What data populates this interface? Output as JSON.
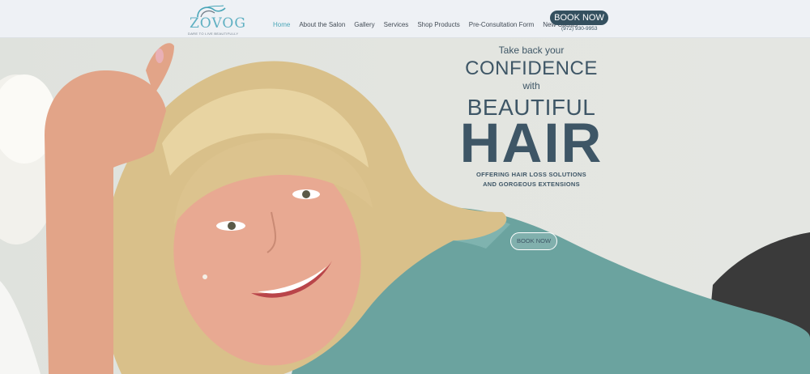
{
  "colors": {
    "accent": "#4aa6b8",
    "brand_dark": "#34505f",
    "hero_text": "#3e5666",
    "nav_bg": "#eef1f5"
  },
  "logo": {
    "word": "ZOVOG",
    "tagline": "DARE TO LIVE BEAUTIFULLY",
    "icon": "hair-swirl-logo-icon"
  },
  "nav": {
    "items": [
      {
        "label": "Home",
        "active": true
      },
      {
        "label": "About the Salon",
        "active": false
      },
      {
        "label": "Gallery",
        "active": false
      },
      {
        "label": "Services",
        "active": false
      },
      {
        "label": "Shop Products",
        "active": false
      },
      {
        "label": "Pre-Consultation Form",
        "active": false
      },
      {
        "label": "New Clients",
        "active": false
      }
    ],
    "book_label": "BOOK NOW",
    "phone": "(972) 930-9953"
  },
  "hero": {
    "line1": "Take back your",
    "line2": "CONFIDENCE",
    "line3": "with",
    "line4": "BEAUTIFUL",
    "line5": "HAIR",
    "sub1": "OFFERING HAIR LOSS SOLUTIONS",
    "sub2": "AND GORGEOUS EXTENSIONS",
    "cta_label": "BOOK NOW"
  }
}
